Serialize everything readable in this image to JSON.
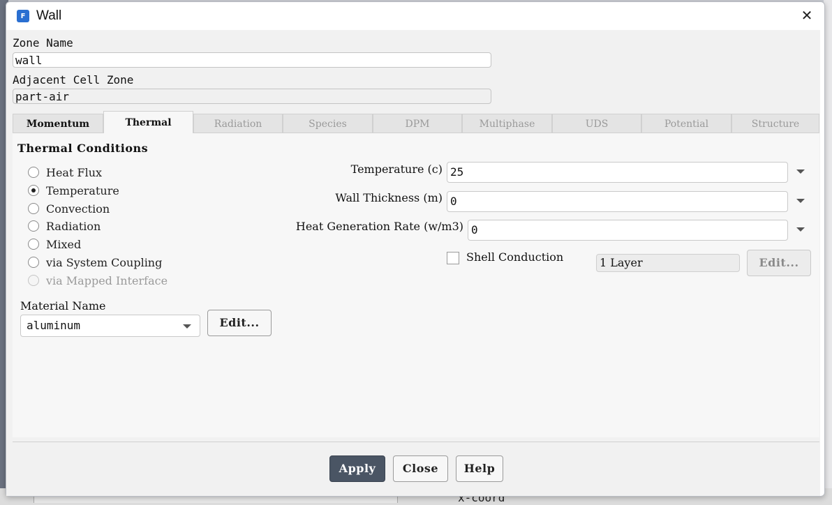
{
  "window": {
    "title": "Wall",
    "icon": "fluent-app-icon",
    "close": "✕"
  },
  "zone": {
    "zone_name_label": "Zone Name",
    "zone_name_value": "wall",
    "adjacent_label": "Adjacent Cell Zone",
    "adjacent_value": "part-air"
  },
  "tabs": [
    {
      "label": "Momentum",
      "state": "enabled"
    },
    {
      "label": "Thermal",
      "state": "active"
    },
    {
      "label": "Radiation",
      "state": "disabled"
    },
    {
      "label": "Species",
      "state": "disabled"
    },
    {
      "label": "DPM",
      "state": "disabled"
    },
    {
      "label": "Multiphase",
      "state": "disabled"
    },
    {
      "label": "UDS",
      "state": "disabled"
    },
    {
      "label": "Potential",
      "state": "disabled"
    },
    {
      "label": "Structure",
      "state": "disabled"
    }
  ],
  "thermal": {
    "section_title": "Thermal Conditions",
    "options": [
      {
        "label": "Heat Flux",
        "checked": false,
        "disabled": false
      },
      {
        "label": "Temperature",
        "checked": true,
        "disabled": false
      },
      {
        "label": "Convection",
        "checked": false,
        "disabled": false
      },
      {
        "label": "Radiation",
        "checked": false,
        "disabled": false
      },
      {
        "label": "Mixed",
        "checked": false,
        "disabled": false
      },
      {
        "label": "via System Coupling",
        "checked": false,
        "disabled": false
      },
      {
        "label": "via Mapped Interface",
        "checked": false,
        "disabled": true
      }
    ],
    "params": {
      "temperature_label": "Temperature (c)",
      "temperature_value": "25",
      "thickness_label": "Wall Thickness (m)",
      "thickness_value": "0",
      "heatgen_label": "Heat Generation Rate (w/m3)",
      "heatgen_value": "0"
    },
    "shell": {
      "label": "Shell Conduction",
      "checked": false,
      "layers_value": "1 Layer",
      "edit_label": "Edit..."
    },
    "material": {
      "label": "Material Name",
      "value": "aluminum",
      "edit_label": "Edit..."
    }
  },
  "buttons": {
    "apply": "Apply",
    "close": "Close",
    "help": "Help"
  },
  "background": {
    "x_coord_label": "x-coord"
  },
  "colors": {
    "apply_bg": "#4a5564",
    "app_icon": "#2a6fd1"
  }
}
